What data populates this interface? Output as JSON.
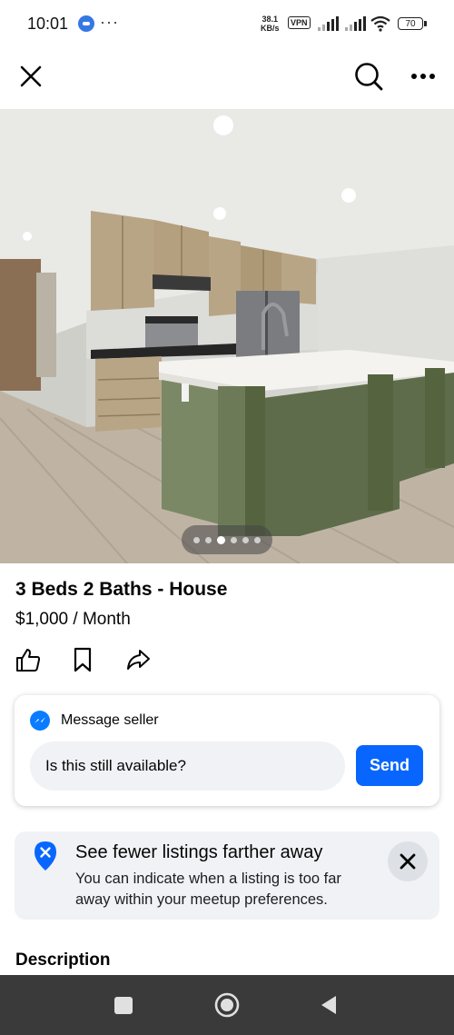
{
  "status_bar": {
    "time": "10:01",
    "more": "···",
    "speed_value": "38.1",
    "speed_unit": "KB/s",
    "vpn": "VPN",
    "battery": "70"
  },
  "listing": {
    "title": "3 Beds 2 Baths - House",
    "price": "$1,000 / Month",
    "photo_count": 6,
    "photo_index": 3
  },
  "message": {
    "title": "Message seller",
    "input_value": "Is this still available?",
    "send_label": "Send"
  },
  "notice": {
    "title": "See fewer listings farther away",
    "body": "You can indicate when a listing is too far away within your meetup preferences."
  },
  "description": {
    "heading": "Description"
  },
  "colors": {
    "accent": "#0866ff",
    "card_gray": "#f0f2f5",
    "nav_bar": "#3a3a3a",
    "cabinet_green": "#6c7a58"
  },
  "icons": [
    "close-icon",
    "search-icon",
    "more-icon",
    "like-icon",
    "save-icon",
    "share-icon",
    "messenger-icon",
    "location-pin-icon",
    "dismiss-icon"
  ]
}
